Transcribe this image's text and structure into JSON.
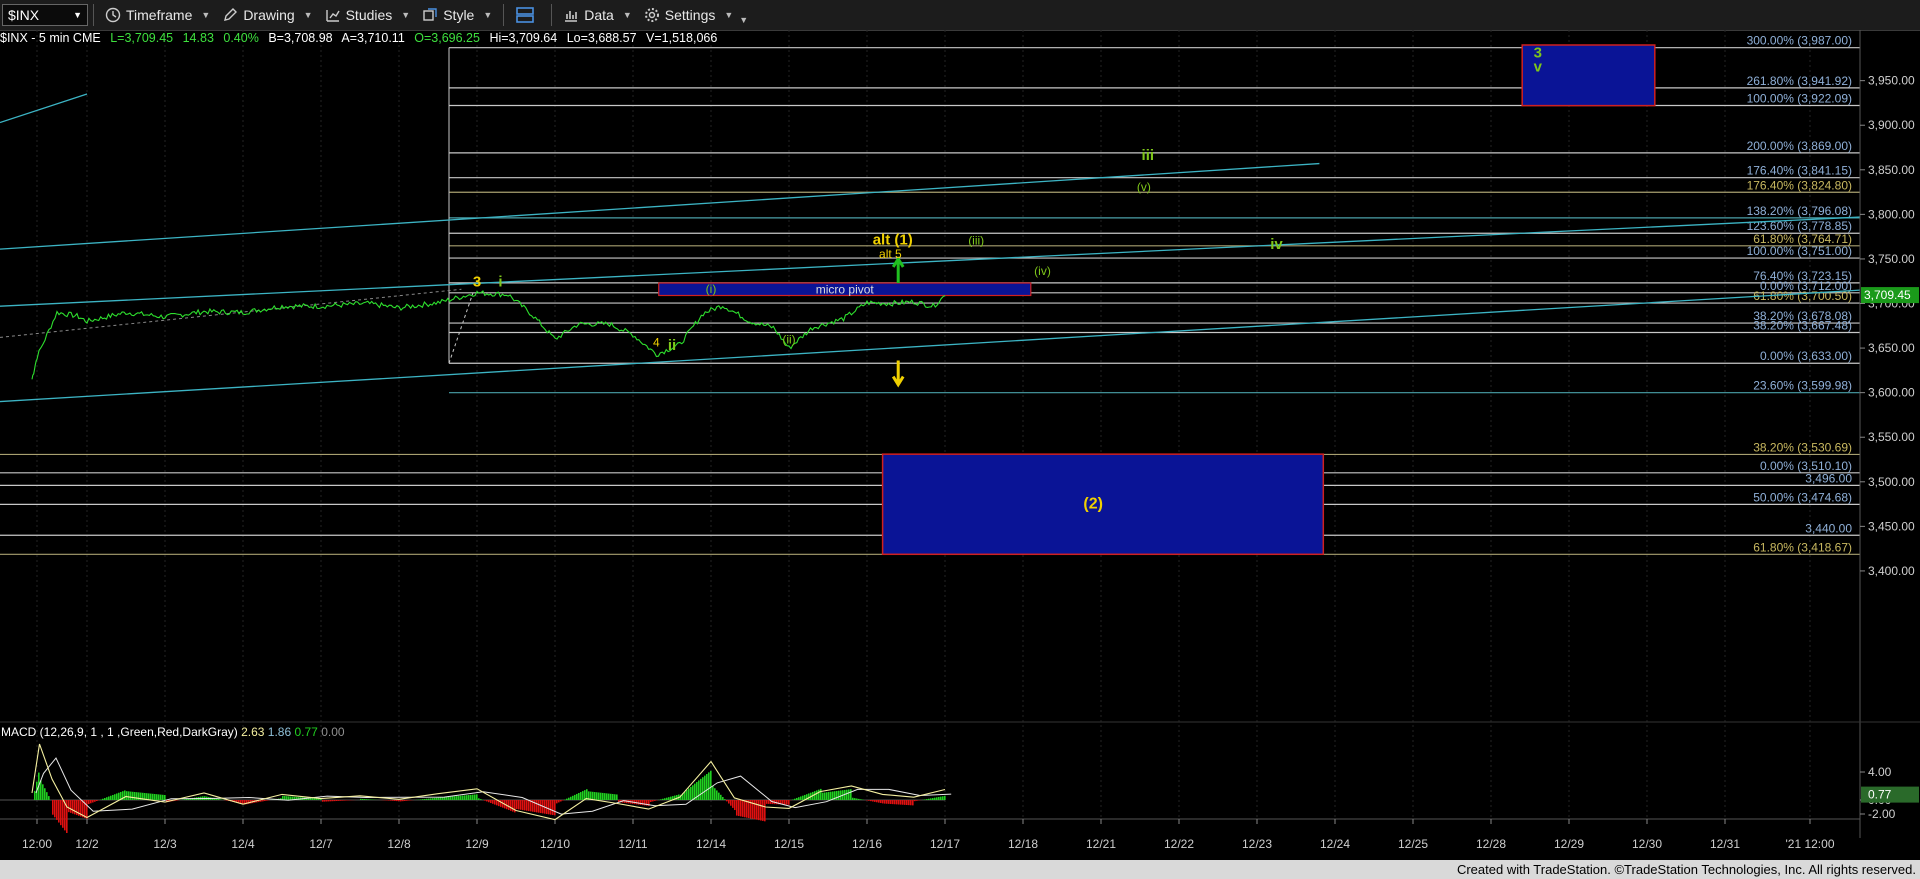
{
  "toolbar": {
    "symbol": "$INX",
    "timeframe_label": "Timeframe",
    "drawing_label": "Drawing",
    "studies_label": "Studies",
    "style_label": "Style",
    "data_label": "Data",
    "settings_label": "Settings"
  },
  "header": {
    "title": "$INX - 5 min  CME",
    "last": "L=3,709.45",
    "change": "14.83",
    "change_pct": "0.40%",
    "bid": "B=3,708.98",
    "ask": "A=3,710.11",
    "open": "O=3,696.25",
    "high": "Hi=3,709.64",
    "low": "Lo=3,688.57",
    "volume": "V=1,518,066"
  },
  "colors": {
    "price": "#2ee02e",
    "fib_label": "#8fb0d8",
    "wave_green": "#7ec61a",
    "wave_yellow": "#f0d000",
    "trend_line": "#3cb4c4",
    "box_fill": "#0a1496",
    "box_border": "#d02020",
    "macd_line": "#f5f0a0",
    "signal_line": "#e8e8e8",
    "hist_pos": "#20d020",
    "hist_neg": "#e01010"
  },
  "price_axis": {
    "ticks": [
      "3,950.00",
      "3,900.00",
      "3,850.00",
      "3,800.00",
      "3,750.00",
      "3,700.00",
      "3,650.00",
      "3,600.00",
      "3,550.00",
      "3,500.00",
      "3,450.00",
      "3,400.00"
    ],
    "last_price": "3,709.45",
    "range": [
      3373,
      3990
    ]
  },
  "time_axis": [
    "12:00",
    "12/2",
    "12/3",
    "12/4",
    "12/7",
    "12/8",
    "12/9",
    "12/10",
    "12/11",
    "12/14",
    "12/15",
    "12/16",
    "12/17",
    "12/18",
    "12/21",
    "12/22",
    "12/23",
    "12/24",
    "12/25",
    "12/28",
    "12/29",
    "12/30",
    "12/31",
    "'21 12:00"
  ],
  "fib_levels": [
    {
      "label": "300.00% (3,987.00)",
      "price": 3987
    },
    {
      "label": "261.80% (3,941.92)",
      "price": 3941.92
    },
    {
      "label": "100.00% (3,922.09)",
      "price": 3922.09
    },
    {
      "label": "200.00% (3,869.00)",
      "price": 3869
    },
    {
      "label": "176.40% (3,841.15)",
      "price": 3841.15
    },
    {
      "label": "176.40% (3,824.80)",
      "price": 3824.8
    },
    {
      "label": "138.20% (3,796.08)",
      "price": 3796.08
    },
    {
      "label": "123.60% (3,778.85)",
      "price": 3778.85
    },
    {
      "label": "61.80% (3,764.71)",
      "price": 3764.71
    },
    {
      "label": "100.00% (3,751.00)",
      "price": 3751
    },
    {
      "label": "76.40% (3,723.15)",
      "price": 3723.15
    },
    {
      "label": "0.00% (3,712.00)",
      "price": 3712
    },
    {
      "label": "61.80% (3,700.50)",
      "price": 3700.5
    },
    {
      "label": "38.20% (3,678.08)",
      "price": 3678.08
    },
    {
      "label": "38.20% (3,667.48)",
      "price": 3667.48
    },
    {
      "label": "0.00% (3,633.00)",
      "price": 3633
    },
    {
      "label": "23.60% (3,599.98)",
      "price": 3599.98
    },
    {
      "label": "38.20% (3,530.69)",
      "price": 3530.69
    },
    {
      "label": "0.00% (3,510.10)",
      "price": 3510.1
    },
    {
      "label": "3,496.00",
      "price": 3496
    },
    {
      "label": "50.00% (3,474.68)",
      "price": 3474.68
    },
    {
      "label": "3,440.00",
      "price": 3440
    },
    {
      "label": "61.80% (3,418.67)",
      "price": 3418.67
    }
  ],
  "wave_labels": [
    {
      "text": "3",
      "day": 6.0,
      "price": 3719,
      "color": "yellow"
    },
    {
      "text": "i",
      "day": 6.3,
      "price": 3719,
      "color": "green"
    },
    {
      "text": "4",
      "day": 8.3,
      "price": 3652,
      "color": "yellow"
    },
    {
      "text": "ii",
      "day": 8.5,
      "price": 3648,
      "color": "green"
    },
    {
      "text": "(i)",
      "day": 9.0,
      "price": 3712,
      "color": "green"
    },
    {
      "text": "(ii)",
      "day": 10.0,
      "price": 3655,
      "color": "green"
    },
    {
      "text": "alt (1)",
      "day": 11.33,
      "price": 3766,
      "color": "yellow"
    },
    {
      "text": "alt 5",
      "day": 11.3,
      "price": 3751,
      "color": "yellow"
    },
    {
      "text": "(iii)",
      "day": 12.4,
      "price": 3766,
      "color": "green"
    },
    {
      "text": "(iv)",
      "day": 13.25,
      "price": 3732,
      "color": "green"
    },
    {
      "text": "iii",
      "day": 14.6,
      "price": 3861,
      "color": "green"
    },
    {
      "text": "(v)",
      "day": 14.55,
      "price": 3826,
      "color": "green"
    },
    {
      "text": "iv",
      "day": 16.25,
      "price": 3761,
      "color": "green"
    },
    {
      "text": "3",
      "day": 19.6,
      "price": 3976,
      "color": "green"
    },
    {
      "text": "v",
      "day": 19.6,
      "price": 3960,
      "color": "green"
    },
    {
      "text": "(2)",
      "day": 13.9,
      "price": 3470,
      "color": "yellow"
    }
  ],
  "annotations": {
    "micro_pivot": "micro pivot"
  },
  "macd": {
    "title": "MACD (12,26,9, 1 , 1 ,Green,Red,DarkGray)",
    "macd_value": "2.63",
    "signal_value": "1.86",
    "hist_value": "0.77",
    "zero_value": "0.00",
    "axis_ticks": [
      "4.00",
      "0.00",
      "-2.00"
    ],
    "last_badge": "0.77"
  },
  "footer": {
    "copyright": "Created with TradeStation. ©TradeStation Technologies, Inc. All rights reserved."
  }
}
